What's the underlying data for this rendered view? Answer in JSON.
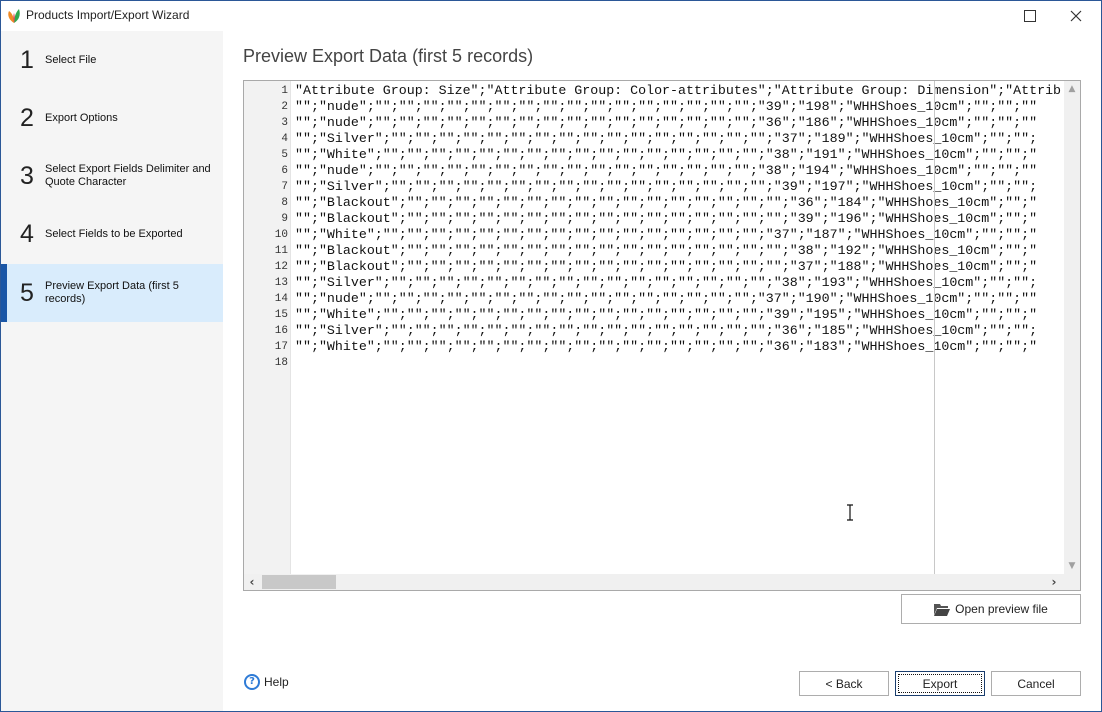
{
  "window": {
    "title": "Products Import/Export Wizard",
    "app_icon": "leaf-logo-icon",
    "maximize_icon": "maximize-icon",
    "close_icon": "close-icon"
  },
  "sidebar": {
    "steps": [
      {
        "number": "1",
        "label": "Select File",
        "active": false
      },
      {
        "number": "2",
        "label": "Export Options",
        "active": false
      },
      {
        "number": "3",
        "label": "Select Export Fields Delimiter and Quote Character",
        "active": false
      },
      {
        "number": "4",
        "label": "Select Fields to be Exported",
        "active": false
      },
      {
        "number": "5",
        "label": "Preview Export Data (first 5 records)",
        "active": true
      }
    ]
  },
  "main": {
    "title": "Preview Export Data (first 5 records)",
    "preview": {
      "line_numbers": [
        "1",
        "2",
        "3",
        "4",
        "5",
        "6",
        "7",
        "8",
        "9",
        "10",
        "11",
        "12",
        "13",
        "14",
        "15",
        "16",
        "17",
        "18"
      ],
      "lines": [
        "\"Attribute Group: Size\";\"Attribute Group: Color-attributes\";\"Attribute Group: Dimension\";\"Attrib",
        "\"\";\"nude\";\"\";\"\";\"\";\"\";\"\";\"\";\"\";\"\";\"\";\"\";\"\";\"\";\"\";\"\";\"\";\"\";\"39\";\"198\";\"WHHShoes_10cm\";\"\";\"\";\"\"",
        "\"\";\"nude\";\"\";\"\";\"\";\"\";\"\";\"\";\"\";\"\";\"\";\"\";\"\";\"\";\"\";\"\";\"\";\"\";\"36\";\"186\";\"WHHShoes_10cm\";\"\";\"\";\"\"",
        "\"\";\"Silver\";\"\";\"\";\"\";\"\";\"\";\"\";\"\";\"\";\"\";\"\";\"\";\"\";\"\";\"\";\"\";\"\";\"37\";\"189\";\"WHHShoes_10cm\";\"\";\"\";",
        "\"\";\"White\";\"\";\"\";\"\";\"\";\"\";\"\";\"\";\"\";\"\";\"\";\"\";\"\";\"\";\"\";\"\";\"\";\"38\";\"191\";\"WHHShoes_10cm\";\"\";\"\";\"",
        "\"\";\"nude\";\"\";\"\";\"\";\"\";\"\";\"\";\"\";\"\";\"\";\"\";\"\";\"\";\"\";\"\";\"\";\"\";\"38\";\"194\";\"WHHShoes_10cm\";\"\";\"\";\"\"",
        "\"\";\"Silver\";\"\";\"\";\"\";\"\";\"\";\"\";\"\";\"\";\"\";\"\";\"\";\"\";\"\";\"\";\"\";\"\";\"39\";\"197\";\"WHHShoes_10cm\";\"\";\"\";",
        "\"\";\"Blackout\";\"\";\"\";\"\";\"\";\"\";\"\";\"\";\"\";\"\";\"\";\"\";\"\";\"\";\"\";\"\";\"\";\"36\";\"184\";\"WHHShoes_10cm\";\"\";\"",
        "\"\";\"Blackout\";\"\";\"\";\"\";\"\";\"\";\"\";\"\";\"\";\"\";\"\";\"\";\"\";\"\";\"\";\"\";\"\";\"39\";\"196\";\"WHHShoes_10cm\";\"\";\"",
        "\"\";\"White\";\"\";\"\";\"\";\"\";\"\";\"\";\"\";\"\";\"\";\"\";\"\";\"\";\"\";\"\";\"\";\"\";\"37\";\"187\";\"WHHShoes_10cm\";\"\";\"\";\"",
        "\"\";\"Blackout\";\"\";\"\";\"\";\"\";\"\";\"\";\"\";\"\";\"\";\"\";\"\";\"\";\"\";\"\";\"\";\"\";\"38\";\"192\";\"WHHShoes_10cm\";\"\";\"",
        "\"\";\"Blackout\";\"\";\"\";\"\";\"\";\"\";\"\";\"\";\"\";\"\";\"\";\"\";\"\";\"\";\"\";\"\";\"\";\"37\";\"188\";\"WHHShoes_10cm\";\"\";\"",
        "\"\";\"Silver\";\"\";\"\";\"\";\"\";\"\";\"\";\"\";\"\";\"\";\"\";\"\";\"\";\"\";\"\";\"\";\"\";\"38\";\"193\";\"WHHShoes_10cm\";\"\";\"\";",
        "\"\";\"nude\";\"\";\"\";\"\";\"\";\"\";\"\";\"\";\"\";\"\";\"\";\"\";\"\";\"\";\"\";\"\";\"\";\"37\";\"190\";\"WHHShoes_10cm\";\"\";\"\";\"\"",
        "\"\";\"White\";\"\";\"\";\"\";\"\";\"\";\"\";\"\";\"\";\"\";\"\";\"\";\"\";\"\";\"\";\"\";\"\";\"39\";\"195\";\"WHHShoes_10cm\";\"\";\"\";\"",
        "\"\";\"Silver\";\"\";\"\";\"\";\"\";\"\";\"\";\"\";\"\";\"\";\"\";\"\";\"\";\"\";\"\";\"\";\"\";\"36\";\"185\";\"WHHShoes_10cm\";\"\";\"\";",
        "\"\";\"White\";\"\";\"\";\"\";\"\";\"\";\"\";\"\";\"\";\"\";\"\";\"\";\"\";\"\";\"\";\"\";\"\";\"36\";\"183\";\"WHHShoes_10cm\";\"\";\"\";\"",
        ""
      ]
    },
    "open_preview_button": "Open preview file"
  },
  "footer": {
    "help_label": "Help",
    "help_icon_glyph": "?",
    "back_label": "< Back",
    "export_label": "Export",
    "cancel_label": "Cancel"
  },
  "colors": {
    "accent": "#1a56a6",
    "active_step_bg": "#d9ecfc",
    "sidebar_bg": "#f5f5f5",
    "help_icon": "#2f7bd6"
  }
}
